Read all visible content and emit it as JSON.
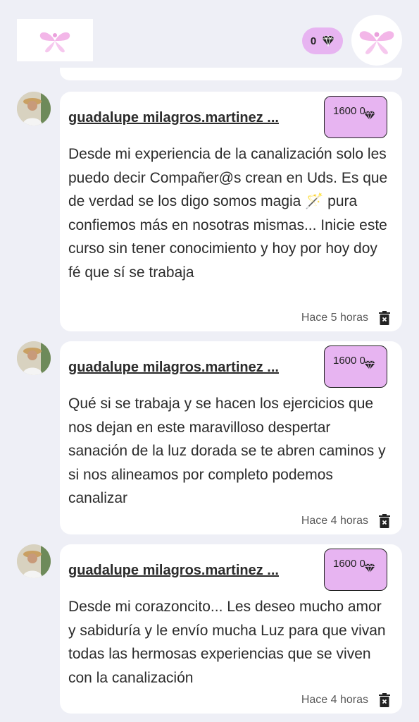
{
  "header": {
    "gem_count": "0",
    "logo_icon": "pink-fairy-wings-logo",
    "profile_icon": "pink-fairy-wings-avatar"
  },
  "colors": {
    "accent": "#e7b4f1",
    "background": "#eeeff6",
    "card": "#ffffff",
    "text": "#2b2b2b"
  },
  "posts": [
    {
      "username": "guadalupe milagros.martinez ...",
      "gems": "1600 0",
      "text": "Desde mi experiencia de la canalización solo les puedo decir Compañer@s crean en Uds. Es que de verdad se los digo somos magia 🪄 pura confiemos más en nosotras mismas... Inicie este curso sin tener conocimiento y hoy por hoy doy fé que sí se trabaja",
      "time": "Hace 5 horas"
    },
    {
      "username": "guadalupe milagros.martinez ...",
      "gems": "1600 0",
      "text": "Qué si se trabaja y se hacen los ejercicios que nos dejan en este maravilloso despertar sanación de la luz dorada se te abren caminos y si nos alineamos por completo podemos canalizar",
      "time": "Hace 4 horas"
    },
    {
      "username": "guadalupe milagros.martinez ...",
      "gems": "1600 0",
      "text": "Desde mi corazoncito... Les deseo mucho amor y sabiduría y le envío mucha Luz para que vivan todas las hermosas experiencias que se viven con la canalización",
      "time": "Hace 4 horas"
    }
  ]
}
